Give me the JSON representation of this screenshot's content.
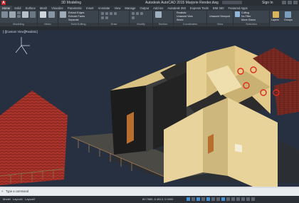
{
  "window": {
    "workspace": "3D Modeling",
    "title": "Autodesk AutoCAD 2015   Marjorie Render.dwg",
    "user": "Sign In"
  },
  "ribbon_tabs": [
    "Home",
    "Solid",
    "Surface",
    "Mesh",
    "Visualize",
    "Parametric",
    "Insert",
    "Annotate",
    "View",
    "Manage",
    "Output",
    "Add-ins",
    "Autodesk 360",
    "Express Tools",
    "BIM 360",
    "Featured Apps"
  ],
  "panels": {
    "modeling": "Modeling",
    "mesh": "Mesh",
    "solid_editing": "Solid Editing",
    "draw": "Draw",
    "modify": "Modify",
    "section": "Section",
    "coordinates": "Coordinates",
    "view": "View",
    "selection": "Selection"
  },
  "ribbon_controls": {
    "extract_edges": "Extract Edges",
    "extrude_faces": "Extrude Faces",
    "separate": "Separate",
    "realistic": "Realistic",
    "unsaved_view": "Unsaved View",
    "unsaved_viewport": "Unsaved Viewport",
    "world": "World",
    "culling": "Culling",
    "no_filter": "No Filter",
    "move_gizmo": "Move Gizmo",
    "layers": "Layers",
    "groups": "Groups"
  },
  "viewport": {
    "label": "[-][Custom View][Realistic]"
  },
  "command_line": {
    "placeholder": "Type a command"
  },
  "status_bar": {
    "tabs": [
      "Model",
      "Layout1",
      "Layout2"
    ],
    "coordinates": "80.7686, 6.4813, 0.0000",
    "mode": "MODEL"
  },
  "colors": {
    "viewport_bg": "#263041",
    "wall_cream": "#e8d49a",
    "roof_tile": "#a8332a",
    "interior_dark": "#3a3a3a",
    "accent_red": "#c8262b"
  }
}
